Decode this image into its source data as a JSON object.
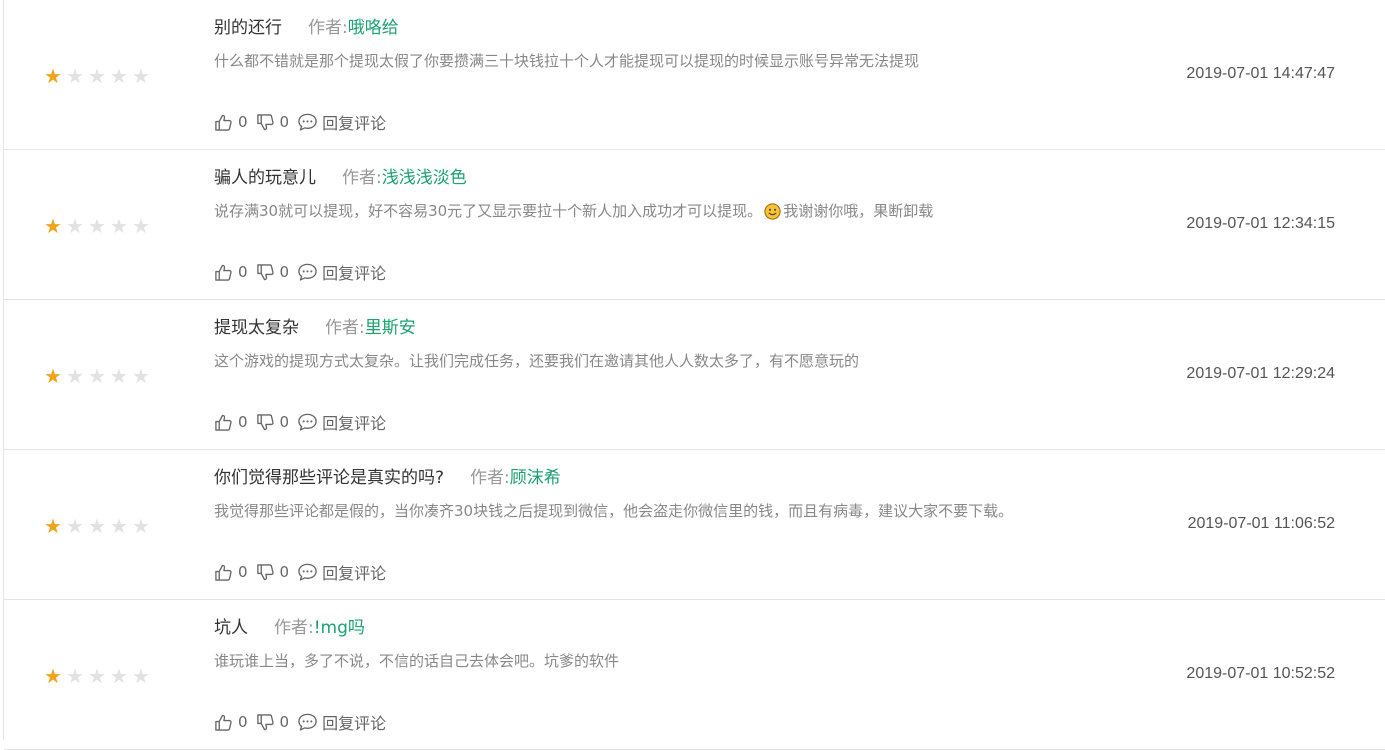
{
  "reviews": [
    {
      "title": "别的还行",
      "author_label": "作者:",
      "author": "哦咯给",
      "content": "什么都不错就是那个提现太假了你要攒满三十块钱拉十个人才能提现可以提现的时候显示账号异常无法提现",
      "date": "2019-07-01 14:47:47",
      "rating": 1,
      "likes": "0",
      "dislikes": "0",
      "reply_label": "回复评论"
    },
    {
      "title": "骗人的玩意儿",
      "author_label": "作者:",
      "author": "浅浅浅淡色",
      "content": "说存满30就可以提现，好不容易30元了又显示要拉十个新人加入成功才可以提现。",
      "content_after_emoji": "我谢谢你哦，果断卸载",
      "emoji": "slightly-smiling-face-icon",
      "date": "2019-07-01 12:34:15",
      "rating": 1,
      "likes": "0",
      "dislikes": "0",
      "reply_label": "回复评论"
    },
    {
      "title": "提现太复杂",
      "author_label": "作者:",
      "author": "里斯安",
      "content": "这个游戏的提现方式太复杂。让我们完成任务，还要我们在邀请其他人人数太多了，有不愿意玩的",
      "date": "2019-07-01 12:29:24",
      "rating": 1,
      "likes": "0",
      "dislikes": "0",
      "reply_label": "回复评论"
    },
    {
      "title": "你们觉得那些评论是真实的吗?",
      "author_label": "作者:",
      "author": "顾沫希",
      "content": "我觉得那些评论都是假的，当你凑齐30块钱之后提现到微信，他会盗走你微信里的钱，而且有病毒，建议大家不要下载。",
      "date": "2019-07-01 11:06:52",
      "rating": 1,
      "likes": "0",
      "dislikes": "0",
      "reply_label": "回复评论"
    },
    {
      "title": "坑人",
      "author_label": "作者:",
      "author": "!mg吗",
      "content": "谁玩谁上当，多了不说，不信的话自己去体会吧。坑爹的软件",
      "date": "2019-07-01 10:52:52",
      "rating": 1,
      "likes": "0",
      "dislikes": "0",
      "reply_label": "回复评论"
    }
  ],
  "colors": {
    "star_filled": "#f0a41c",
    "star_empty": "#e2e2e2",
    "author_name": "#1aa36f",
    "content_text": "#888888",
    "divider": "#e4e4e4"
  },
  "max_rating": 5
}
